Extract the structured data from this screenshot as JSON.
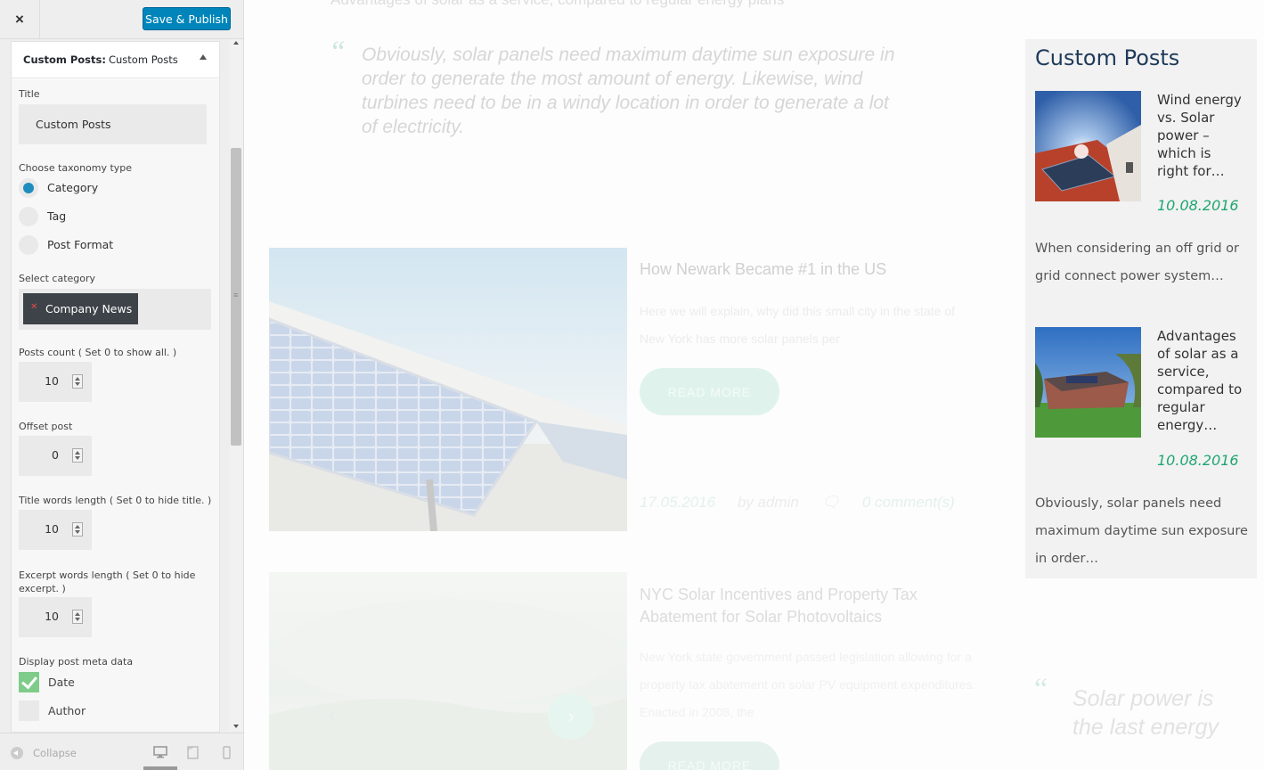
{
  "customizer": {
    "close_label": "×",
    "publish_label": "Save & Publish",
    "widget": {
      "type_label": "Custom Posts:",
      "instance_label": "Custom Posts",
      "title_label": "Title",
      "title_value": "Custom Posts",
      "taxonomy_label": "Choose taxonomy type",
      "taxonomy_options": [
        "Category",
        "Tag",
        "Post Format"
      ],
      "taxonomy_selected": "Category",
      "category_label": "Select category",
      "category_selected": "Company News",
      "posts_count_label": "Posts count ( Set 0 to show all. )",
      "posts_count_value": "10",
      "offset_label": "Offset post",
      "offset_value": "0",
      "title_words_label": "Title words length ( Set 0 to hide title. )",
      "title_words_value": "10",
      "excerpt_words_label": "Excerpt words length ( Set 0 to hide excerpt. )",
      "excerpt_words_value": "10",
      "meta_label": "Display post meta data",
      "meta_options": [
        {
          "label": "Date",
          "checked": true
        },
        {
          "label": "Author",
          "checked": false
        }
      ]
    },
    "footer": {
      "collapse_label": "Collapse",
      "devices": [
        "desktop-icon",
        "tablet-icon",
        "mobile-icon"
      ]
    }
  },
  "preview": {
    "top_fade_text": "Advantages of solar as a service, compared to regular energy plans",
    "quote1": "Obviously, solar panels need maximum daytime sun exposure in order to generate the most amount of energy. Likewise, wind turbines need to be in a windy location in order to generate a lot of electricity.",
    "post1": {
      "title": "How Newark Became #1 in the US",
      "excerpt": "Here we will explain, why did this small city in the state of New York has more solar panels per",
      "read_more": "READ MORE",
      "date": "17.05.2016",
      "author": "by admin",
      "comments": "0 comment(s)"
    },
    "post2": {
      "title": "NYC Solar Incentives and Property Tax Abatement for Solar Photovoltaics",
      "excerpt": "New York state government passed legislation allowing for a property tax abatement on solar PV equipment expenditures. Enacted in 2008, the",
      "read_more": "READ MORE"
    },
    "widget": {
      "title": "Custom Posts",
      "posts": [
        {
          "title": "Wind energy vs. Solar power – which is right for…",
          "date": "10.08.2016",
          "excerpt": "When considering an off grid or grid connect power system…"
        },
        {
          "title": "Advantages of solar as a service, compared to regular energy…",
          "date": "10.08.2016",
          "excerpt": "Obviously, solar panels need maximum daytime sun exposure in order…"
        }
      ]
    },
    "quote2": "Solar power is the last energy",
    "colors": {
      "accent_green": "#1fa672",
      "publish_blue": "#0085ba",
      "widget_title": "#1e3a5a"
    }
  }
}
